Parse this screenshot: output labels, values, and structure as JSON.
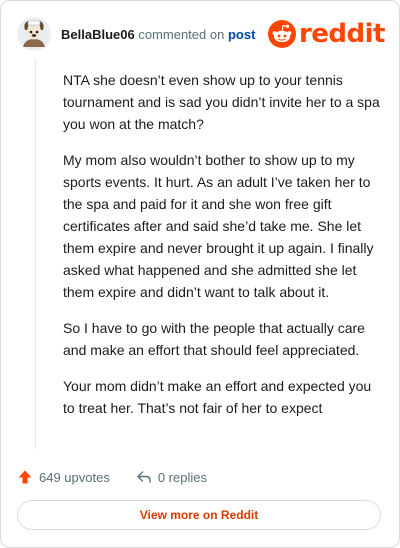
{
  "comment": {
    "username": "BellaBlue06",
    "action_text": "commented on",
    "post_link": "post",
    "paragraphs": [
      "NTA she doesn’t even show up to your tennis tournament and is sad you didn’t invite her to a spa you won at the match?",
      "My mom also wouldn’t bother to show up to my sports events. It hurt. As an adult I’ve taken her to the spa and paid for it and she won free gift certificates after and said she’d take me. She let them expire and never brought it up again. I finally asked what happened and she admitted she let them expire and didn’t want to talk about it.",
      "So I have to go with the people that actually care and make an effort that should feel appreciated.",
      "Your mom didn’t make an effort and expected you to treat her. That’s not fair of her to expect"
    ]
  },
  "brand": {
    "logo_text": "reddit",
    "icon": "reddit-snoo-icon",
    "color": "#ff4500"
  },
  "actions": {
    "upvotes_label": "649 upvotes",
    "replies_label": "0 replies",
    "upvote_icon": "upvote-arrow-icon",
    "reply_icon": "reply-icon",
    "upvote_color": "#ff4500"
  },
  "footer": {
    "view_more_label": "View more on Reddit",
    "link_color": "#d93a00"
  }
}
